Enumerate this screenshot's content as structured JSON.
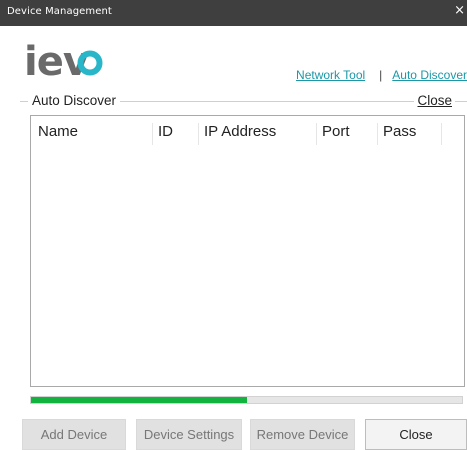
{
  "window": {
    "title": "Device Management",
    "close_glyph": "×"
  },
  "header": {
    "logo_text": "ievo",
    "links": {
      "network_tool": "Network Tool",
      "separator": "|",
      "auto_discover": "Auto Discover"
    }
  },
  "auto_discover_panel": {
    "label": "Auto Discover",
    "close_label": "Close",
    "table": {
      "columns": [
        "Name",
        "ID",
        "IP Address",
        "Port",
        "Pass"
      ],
      "rows": []
    },
    "progress": {
      "fraction": 0.5,
      "color": "#12b33f"
    }
  },
  "buttons": {
    "add_device": "Add Device",
    "device_settings": "Device Settings",
    "remove_device": "Remove Device",
    "close": "Close"
  },
  "colors": {
    "titlebar": "#3f3f3f",
    "link": "#1a98a8",
    "logo_gray": "#6a6a6a",
    "logo_teal": "#29b6c8"
  }
}
